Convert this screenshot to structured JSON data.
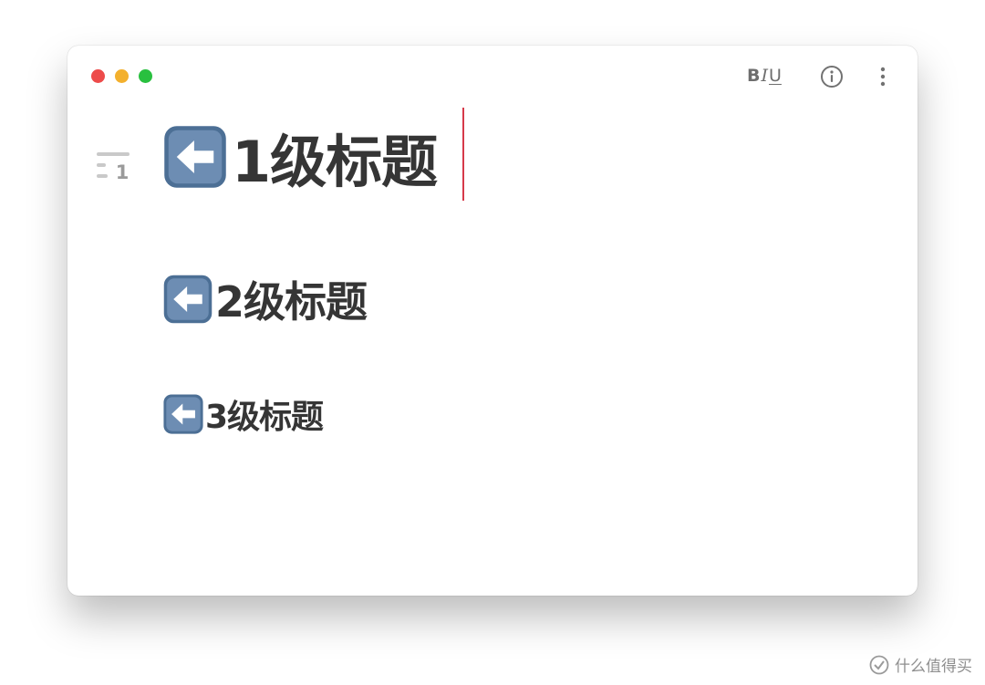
{
  "window": {
    "traffic_lights": {
      "close_color": "#ed4b4a",
      "minimize_color": "#f3b02d",
      "zoom_color": "#29c03f"
    },
    "toolbar": {
      "format_bold_label": "B",
      "format_italic_label": "I",
      "format_underline_label": "U",
      "info_icon": "info-circle-icon",
      "more_icon": "vertical-ellipsis-icon"
    }
  },
  "sidebar": {
    "outline_icon": "heading-outline-icon",
    "outline_level": "1"
  },
  "editor": {
    "headings": [
      {
        "level": 1,
        "icon": "left-arrow-button-emoji",
        "text": "1级标题"
      },
      {
        "level": 2,
        "icon": "left-arrow-button-emoji",
        "text": "2级标题"
      },
      {
        "level": 3,
        "icon": "left-arrow-button-emoji",
        "text": "3级标题"
      }
    ],
    "caret_color": "#d63a4a"
  },
  "watermark": {
    "text": "什么值得买"
  }
}
